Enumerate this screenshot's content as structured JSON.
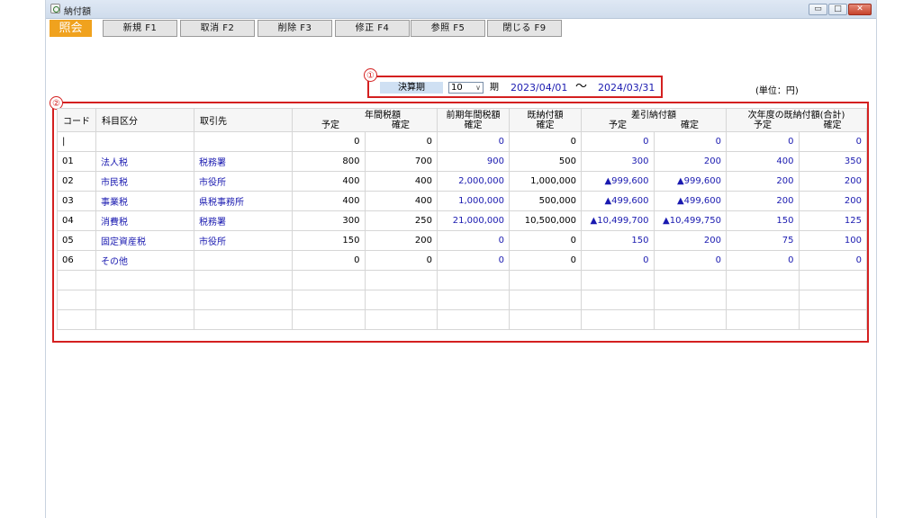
{
  "window": {
    "title": "納付額",
    "buttons": {
      "minimize": "▭",
      "maximize": "□",
      "close": "✕"
    }
  },
  "toolbar": {
    "mode": "照会",
    "buttons": [
      "新規 F1",
      "取消 F2",
      "削除 F3",
      "修正 F4",
      "参照 F5",
      "閉じる F9"
    ]
  },
  "period": {
    "label": "決算期",
    "value": "10",
    "unit": "期",
    "from": "2023/04/01",
    "tilde": "〜",
    "to": "2024/03/31"
  },
  "unit_note": "(単位：円)",
  "markers": {
    "one": "①",
    "two": "②"
  },
  "table": {
    "headers": {
      "code": "コード",
      "category": "科目区分",
      "vendor": "取引先",
      "annual_tax": "年間税額",
      "annual_plan": "予定",
      "annual_final": "確定",
      "prev_tax": "前期年間税額",
      "prev_final": "確定",
      "paid": "既納付額",
      "paid_final": "確定",
      "diff": "差引納付額",
      "diff_plan": "予定",
      "diff_final": "確定",
      "next": "次年度の既納付額(合計)",
      "next_plan": "予定",
      "next_final": "確定"
    },
    "rows": [
      [
        "|",
        "",
        "",
        "0",
        "0",
        "0",
        "0",
        "0",
        "0",
        "0",
        "0"
      ],
      [
        "01",
        "法人税",
        "税務署",
        "800",
        "700",
        "900",
        "500",
        "300",
        "200",
        "400",
        "350"
      ],
      [
        "02",
        "市民税",
        "市役所",
        "400",
        "400",
        "2,000,000",
        "1,000,000",
        "▲999,600",
        "▲999,600",
        "200",
        "200"
      ],
      [
        "03",
        "事業税",
        "県税事務所",
        "400",
        "400",
        "1,000,000",
        "500,000",
        "▲499,600",
        "▲499,600",
        "200",
        "200"
      ],
      [
        "04",
        "消費税",
        "税務署",
        "300",
        "250",
        "21,000,000",
        "10,500,000",
        "▲10,499,700",
        "▲10,499,750",
        "150",
        "125"
      ],
      [
        "05",
        "固定資産税",
        "市役所",
        "150",
        "200",
        "0",
        "0",
        "150",
        "200",
        "75",
        "100"
      ],
      [
        "06",
        "その他",
        "",
        "0",
        "0",
        "0",
        "0",
        "0",
        "0",
        "0",
        "0"
      ]
    ],
    "empty_rows": 3
  },
  "colors": {
    "accent_red": "#d42020",
    "link_blue": "#1a1ab0",
    "mode_orange": "#f0a21e",
    "label_blue": "#cfe0f3"
  }
}
